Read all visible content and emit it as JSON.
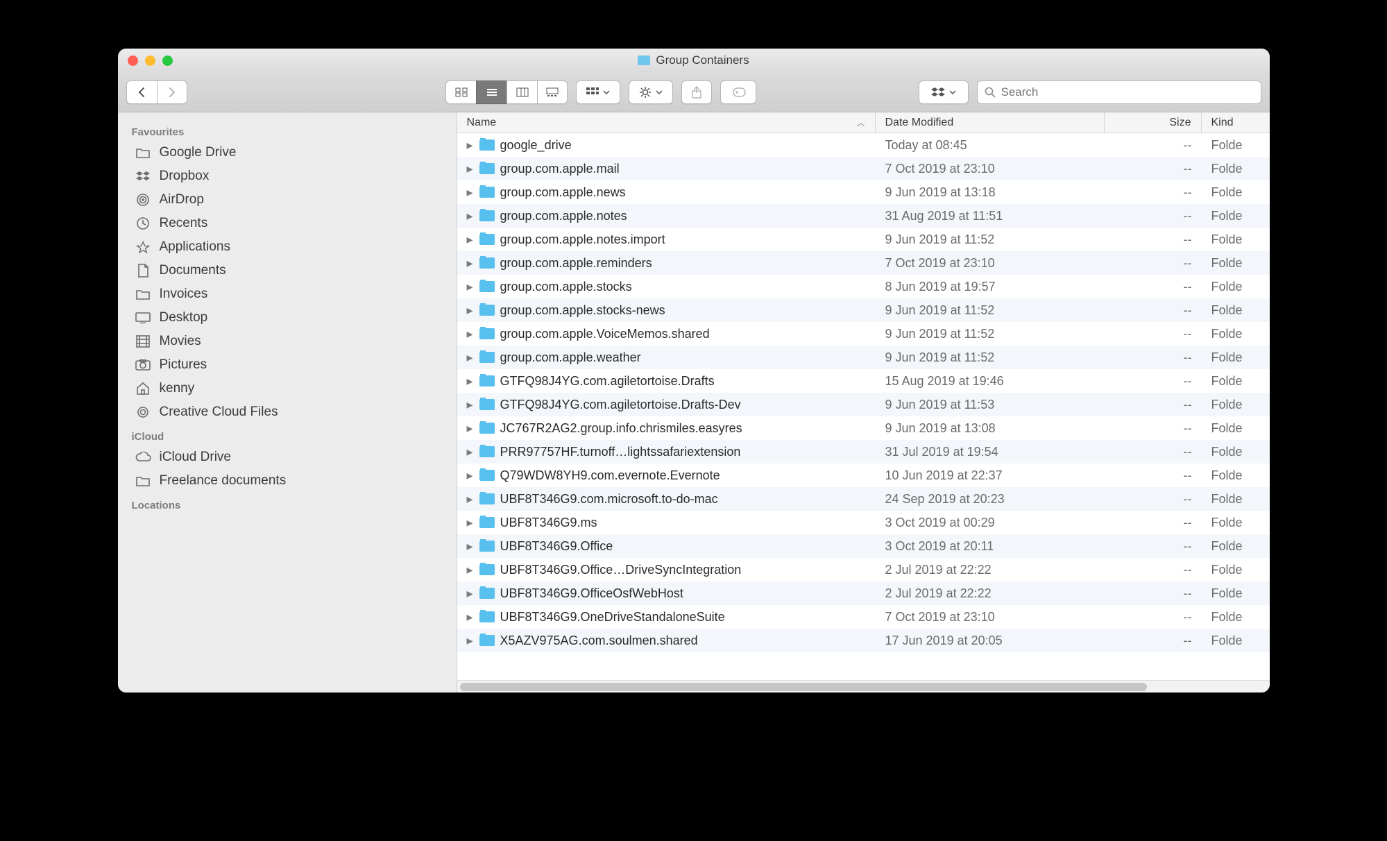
{
  "window": {
    "title": "Group Containers"
  },
  "toolbar": {
    "search_placeholder": "Search"
  },
  "sidebar": {
    "sections": [
      {
        "header": "Favourites",
        "items": [
          {
            "icon": "folder",
            "label": "Google Drive"
          },
          {
            "icon": "dropbox",
            "label": "Dropbox"
          },
          {
            "icon": "airdrop",
            "label": "AirDrop"
          },
          {
            "icon": "recents",
            "label": "Recents"
          },
          {
            "icon": "apps",
            "label": "Applications"
          },
          {
            "icon": "documents",
            "label": "Documents"
          },
          {
            "icon": "folder",
            "label": "Invoices"
          },
          {
            "icon": "desktop",
            "label": "Desktop"
          },
          {
            "icon": "movies",
            "label": "Movies"
          },
          {
            "icon": "pictures",
            "label": "Pictures"
          },
          {
            "icon": "home",
            "label": "kenny"
          },
          {
            "icon": "cc",
            "label": "Creative Cloud Files"
          }
        ]
      },
      {
        "header": "iCloud",
        "items": [
          {
            "icon": "cloud",
            "label": "iCloud Drive"
          },
          {
            "icon": "folder",
            "label": "Freelance documents"
          }
        ]
      },
      {
        "header": "Locations",
        "items": []
      }
    ]
  },
  "columns": {
    "name": "Name",
    "date": "Date Modified",
    "size": "Size",
    "kind": "Kind"
  },
  "files": [
    {
      "name": "google_drive",
      "date": "Today at 08:45",
      "size": "--",
      "kind": "Folde"
    },
    {
      "name": "group.com.apple.mail",
      "date": "7 Oct 2019 at 23:10",
      "size": "--",
      "kind": "Folde"
    },
    {
      "name": "group.com.apple.news",
      "date": "9 Jun 2019 at 13:18",
      "size": "--",
      "kind": "Folde"
    },
    {
      "name": "group.com.apple.notes",
      "date": "31 Aug 2019 at 11:51",
      "size": "--",
      "kind": "Folde"
    },
    {
      "name": "group.com.apple.notes.import",
      "date": "9 Jun 2019 at 11:52",
      "size": "--",
      "kind": "Folde"
    },
    {
      "name": "group.com.apple.reminders",
      "date": "7 Oct 2019 at 23:10",
      "size": "--",
      "kind": "Folde"
    },
    {
      "name": "group.com.apple.stocks",
      "date": "8 Jun 2019 at 19:57",
      "size": "--",
      "kind": "Folde"
    },
    {
      "name": "group.com.apple.stocks-news",
      "date": "9 Jun 2019 at 11:52",
      "size": "--",
      "kind": "Folde"
    },
    {
      "name": "group.com.apple.VoiceMemos.shared",
      "date": "9 Jun 2019 at 11:52",
      "size": "--",
      "kind": "Folde"
    },
    {
      "name": "group.com.apple.weather",
      "date": "9 Jun 2019 at 11:52",
      "size": "--",
      "kind": "Folde"
    },
    {
      "name": "GTFQ98J4YG.com.agiletortoise.Drafts",
      "date": "15 Aug 2019 at 19:46",
      "size": "--",
      "kind": "Folde"
    },
    {
      "name": "GTFQ98J4YG.com.agiletortoise.Drafts-Dev",
      "date": "9 Jun 2019 at 11:53",
      "size": "--",
      "kind": "Folde"
    },
    {
      "name": "JC767R2AG2.group.info.chrismiles.easyres",
      "date": "9 Jun 2019 at 13:08",
      "size": "--",
      "kind": "Folde"
    },
    {
      "name": "PRR97757HF.turnoff…lightssafariextension",
      "date": "31 Jul 2019 at 19:54",
      "size": "--",
      "kind": "Folde"
    },
    {
      "name": "Q79WDW8YH9.com.evernote.Evernote",
      "date": "10 Jun 2019 at 22:37",
      "size": "--",
      "kind": "Folde"
    },
    {
      "name": "UBF8T346G9.com.microsoft.to-do-mac",
      "date": "24 Sep 2019 at 20:23",
      "size": "--",
      "kind": "Folde"
    },
    {
      "name": "UBF8T346G9.ms",
      "date": "3 Oct 2019 at 00:29",
      "size": "--",
      "kind": "Folde"
    },
    {
      "name": "UBF8T346G9.Office",
      "date": "3 Oct 2019 at 20:11",
      "size": "--",
      "kind": "Folde"
    },
    {
      "name": "UBF8T346G9.Office…DriveSyncIntegration",
      "date": "2 Jul 2019 at 22:22",
      "size": "--",
      "kind": "Folde"
    },
    {
      "name": "UBF8T346G9.OfficeOsfWebHost",
      "date": "2 Jul 2019 at 22:22",
      "size": "--",
      "kind": "Folde"
    },
    {
      "name": "UBF8T346G9.OneDriveStandaloneSuite",
      "date": "7 Oct 2019 at 23:10",
      "size": "--",
      "kind": "Folde"
    },
    {
      "name": "X5AZV975AG.com.soulmen.shared",
      "date": "17 Jun 2019 at 20:05",
      "size": "--",
      "kind": "Folde"
    }
  ]
}
